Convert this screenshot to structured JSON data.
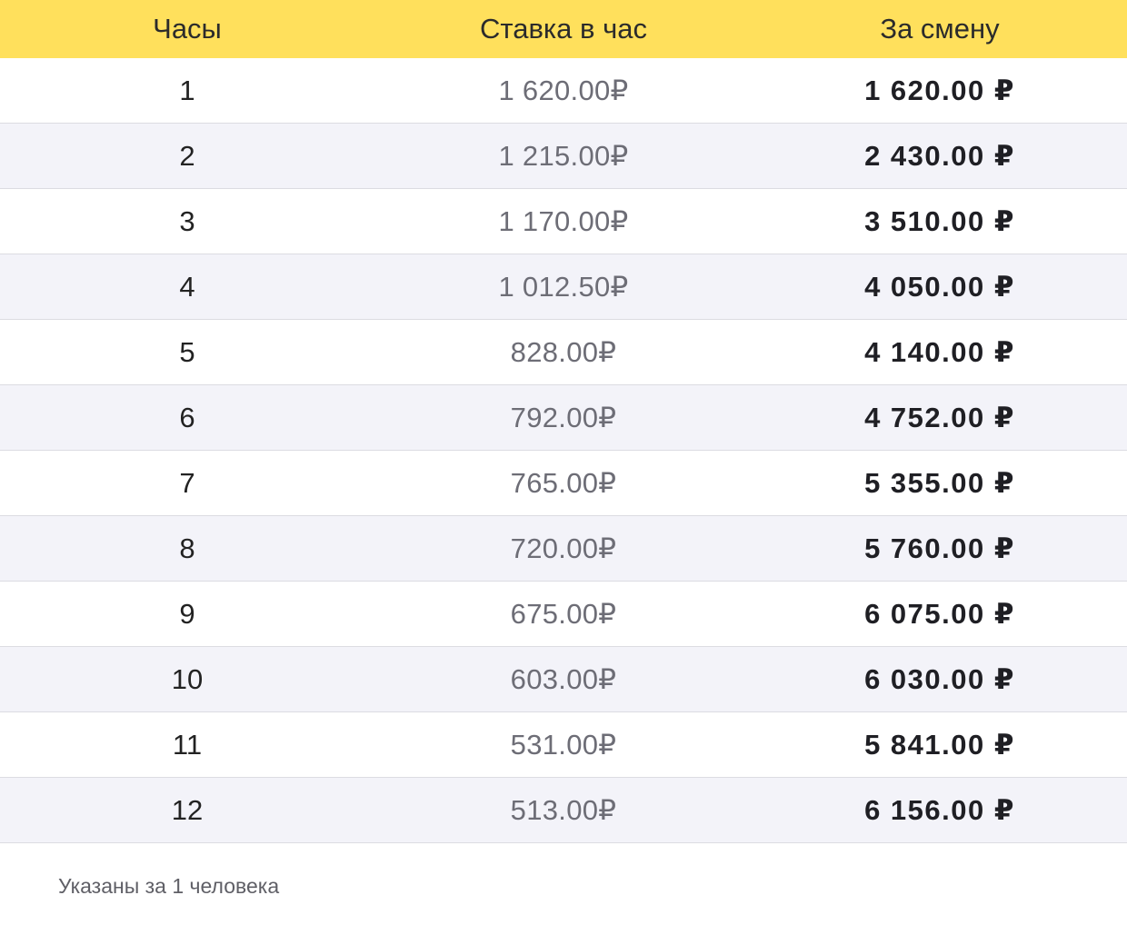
{
  "table": {
    "headers": {
      "hours": "Часы",
      "rate": "Ставка в час",
      "shift": "За смену"
    },
    "rows": [
      {
        "hours": "1",
        "rate": "1 620.00₽",
        "shift": "1 620.00 ₽"
      },
      {
        "hours": "2",
        "rate": "1 215.00₽",
        "shift": "2 430.00 ₽"
      },
      {
        "hours": "3",
        "rate": "1 170.00₽",
        "shift": "3 510.00 ₽"
      },
      {
        "hours": "4",
        "rate": "1 012.50₽",
        "shift": "4 050.00 ₽"
      },
      {
        "hours": "5",
        "rate": "828.00₽",
        "shift": "4 140.00 ₽"
      },
      {
        "hours": "6",
        "rate": "792.00₽",
        "shift": "4 752.00 ₽"
      },
      {
        "hours": "7",
        "rate": "765.00₽",
        "shift": "5 355.00 ₽"
      },
      {
        "hours": "8",
        "rate": "720.00₽",
        "shift": "5 760.00 ₽"
      },
      {
        "hours": "9",
        "rate": "675.00₽",
        "shift": "6 075.00 ₽"
      },
      {
        "hours": "10",
        "rate": "603.00₽",
        "shift": "6 030.00 ₽"
      },
      {
        "hours": "11",
        "rate": "531.00₽",
        "shift": "5 841.00 ₽"
      },
      {
        "hours": "12",
        "rate": "513.00₽",
        "shift": "6 156.00 ₽"
      }
    ]
  },
  "footnote": "Указаны за 1 человека",
  "colors": {
    "header_bg": "#ffe05c",
    "row_alt_bg": "#f3f3f9",
    "row_bg": "#ffffff"
  }
}
